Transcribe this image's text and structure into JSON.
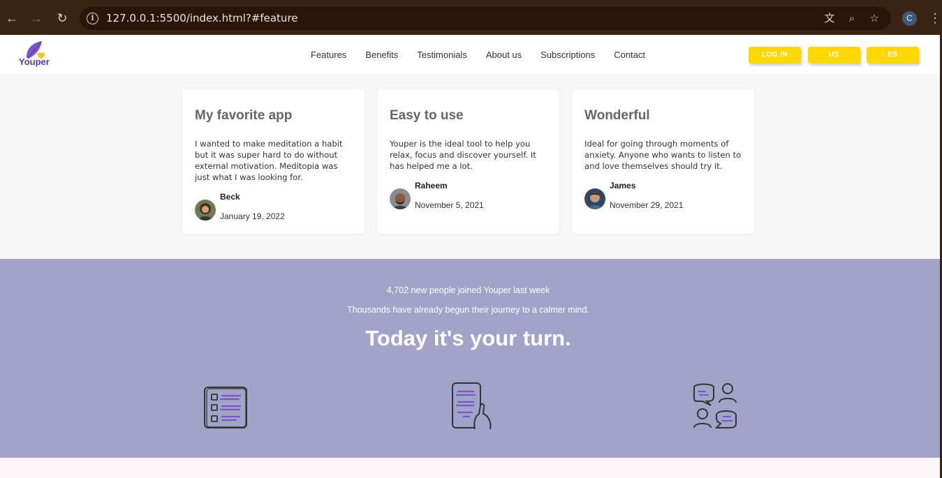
{
  "browser": {
    "url": "127.0.0.1:5500/index.html?#feature",
    "profile_initial": "C"
  },
  "header": {
    "logo_text": "Youper",
    "menu": [
      "Features",
      "Benefits",
      "Testimonials",
      "About us",
      "Subscriptions",
      "Contact"
    ],
    "buttons": {
      "login": "LOG IN",
      "us": "US",
      "es": "ES"
    },
    "button_color": "#ffd800"
  },
  "testimonials": [
    {
      "title": "My favorite app",
      "text": "I wanted to make meditation a habit but it was super hard to do without external motivation. Meditopia was just what I was looking for.",
      "name": "Beck",
      "date": "January 19, 2022"
    },
    {
      "title": "Easy to use",
      "text": "Youper is the ideal tool to help you relax, focus and discover yourself. It has helped me a lot.",
      "name": "Raheem",
      "date": "November 5, 2021"
    },
    {
      "title": "Wonderful",
      "text": "Ideal for going through moments of anxiety. Anyone who wants to listen to and love themselves should try it.",
      "name": "James",
      "date": "November 29, 2021"
    }
  ],
  "cta": {
    "line1": "4,702 new people joined Youper last week",
    "line2": "Thousands have already begun their journey to a calmer mind.",
    "heading": "Today it's your turn.",
    "background": "#a1a4c8",
    "icons": [
      "checklist-icon",
      "phone-list-icon",
      "conversation-icon"
    ]
  }
}
